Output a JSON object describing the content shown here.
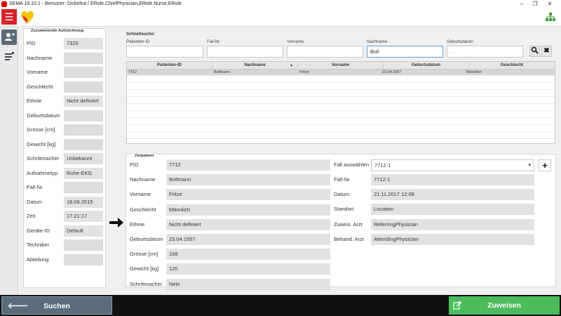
{
  "window": {
    "title": "SEMA 19.10.1 - Benutzer: Dickehut / ERole.ChiefPhysician,ERole.Nurse,ERole",
    "minimize": "–",
    "maximize": "❐",
    "close": "✕"
  },
  "colors": {
    "accent_red": "#d8232a",
    "nav_active": "#5b6a7a",
    "suchen_bg": "#5c6b7a",
    "zuweisen_bg": "#4cbb5c",
    "focus_border": "#5aa0d6"
  },
  "menu_icon": "☰",
  "left_panel": {
    "legend": "Zuzuweisende Aufzeichnung",
    "fields": [
      {
        "label": "PID",
        "value": "7320"
      },
      {
        "label": "Nachname",
        "value": ""
      },
      {
        "label": "Vorname",
        "value": ""
      },
      {
        "label": "Geschlecht",
        "value": ""
      },
      {
        "label": "Ethnie",
        "value": "Nicht definiert"
      },
      {
        "label": "Geburtsdatum",
        "value": ""
      },
      {
        "label": "Grösse [cm]",
        "value": ""
      },
      {
        "label": "Gewicht [kg]",
        "value": ""
      },
      {
        "label": "Schrittmacher",
        "value": "Unbekannt"
      },
      {
        "label": "Aufnahmetyp",
        "value": "Ruhe-EKG"
      },
      {
        "label": "Fall-Nr.",
        "value": ""
      },
      {
        "label": "Datum",
        "value": "18.06.2015"
      },
      {
        "label": "Zeit",
        "value": "17:21:17"
      },
      {
        "label": "Geräte-ID",
        "value": "Default"
      },
      {
        "label": "Techniker",
        "value": ""
      },
      {
        "label": "Abteilung",
        "value": ""
      }
    ]
  },
  "quick_search": {
    "title": "Schnellsuche:",
    "fields": [
      {
        "label": "Patienten-ID",
        "value": ""
      },
      {
        "label": "Fall-Nr.",
        "value": ""
      },
      {
        "label": "Vorname",
        "value": ""
      },
      {
        "label": "Nachname",
        "value": "Boll"
      },
      {
        "label": "Geburtsdatum",
        "value": "  .  ."
      }
    ],
    "search_icon": "🔍",
    "clear_icon": "✖"
  },
  "results_table": {
    "columns": [
      "Patienten-ID",
      "Nachname",
      "Vorname",
      "Geburtsdatum",
      "Geschlecht"
    ],
    "sort_indicator": "▲",
    "rows": [
      [
        "7712",
        "Bollmann",
        "Fritze",
        "23.04.1957",
        "Männlich"
      ]
    ]
  },
  "target_patient": {
    "legend": "Zielpatient",
    "left_fields": [
      {
        "label": "PID",
        "value": "7712"
      },
      {
        "label": "Nachname",
        "value": "Bollmann"
      },
      {
        "label": "Vorname",
        "value": "Fritze"
      },
      {
        "label": "Geschlecht",
        "value": "Männlich"
      },
      {
        "label": "Ethnie",
        "value": "Nicht definiert"
      },
      {
        "label": "Geburtsdatum",
        "value": "23.04.1957"
      },
      {
        "label": "Grösse [cm]",
        "value": "168"
      },
      {
        "label": "Gewicht [kg]",
        "value": "120"
      },
      {
        "label": "Schrittmacher",
        "value": "Nein"
      }
    ],
    "case_select": {
      "label": "Fall auswählen",
      "value": "7712-1"
    },
    "add_label": "+",
    "right_fields": [
      {
        "label": "Fall-Nr.",
        "value": "7712-1"
      },
      {
        "label": "Datum",
        "value": "21.11.2017 12:09"
      },
      {
        "label": "Standort",
        "value": "Location"
      },
      {
        "label": "Zuweis. Arzt",
        "value": "ReferringPhysician"
      },
      {
        "label": "Behand. Arzt",
        "value": "AttendingPhysician"
      }
    ]
  },
  "footer": {
    "back_icon": "🡐",
    "search_label": "Suchen",
    "assign_label": "Zuweisen"
  }
}
